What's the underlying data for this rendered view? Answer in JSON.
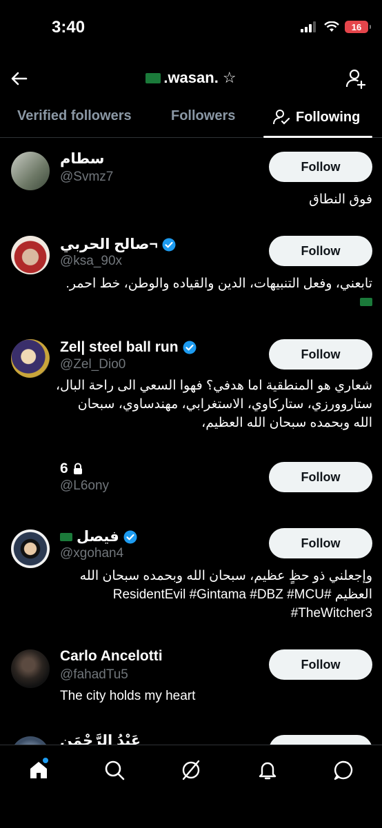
{
  "status": {
    "time": "3:40",
    "battery": "16"
  },
  "header": {
    "title": ".wasan. ☆"
  },
  "tabs": [
    {
      "label": "Verified followers"
    },
    {
      "label": "Followers"
    },
    {
      "label": "Following"
    }
  ],
  "follow_label": "Follow",
  "users": [
    {
      "name": "سطام",
      "handle": "@Svmz7",
      "bio": "فوق النطاق"
    },
    {
      "name": "صالح الحربي¬",
      "handle": "@ksa_90x",
      "bio": "تابعني، وفعل التنبيهات، الدين والقياده والوطن، خط احمر."
    },
    {
      "name": "Zel| steel ball run",
      "handle": "@Zel_Dio0",
      "bio": "شعاري هو المنطقية اما هدفي؟ فهوا السعي الى راحة البال، ستاروورزي، ستاركاوي، الاستغرابي، مهندساوي، سبحان الله وبحمده سبحان الله العظيم،"
    },
    {
      "name": "6",
      "handle": "@L6ony",
      "bio": ""
    },
    {
      "name": "فيصل",
      "handle": "@xgohan4",
      "bio": "وإجعلني ذو حظٍ عظيم، سبحان الله وبحمده سبحان الله العظيم #ResidentEvil #Gintama #DBZ #MCU #TheWitcher3"
    },
    {
      "name": "Carlo Ancelotti",
      "handle": "@fahadTu5",
      "bio": "The city holds my heart"
    },
    {
      "name": "عَبْدُ الرَّحْمَن",
      "handle": "",
      "bio": ""
    }
  ],
  "colors": {
    "accent": "#1d9bf0",
    "background": "#000000",
    "button": "#eff3f4",
    "flag": "#1b7a3a"
  }
}
